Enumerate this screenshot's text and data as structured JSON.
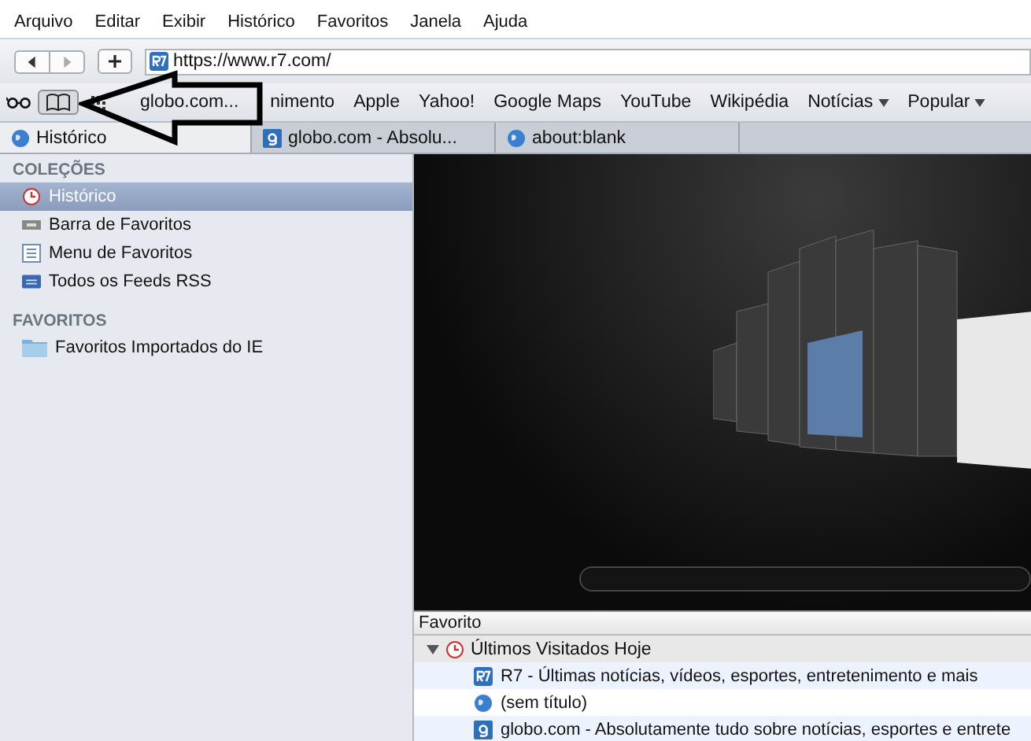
{
  "menu": [
    "Arquivo",
    "Editar",
    "Exibir",
    "Histórico",
    "Favoritos",
    "Janela",
    "Ajuda"
  ],
  "address": {
    "value": "https://www.r7.com/"
  },
  "bookmarks": [
    {
      "label": "globo.com...",
      "menu": false
    },
    {
      "label": "nimento",
      "menu": false
    },
    {
      "label": "Apple",
      "menu": false
    },
    {
      "label": "Yahoo!",
      "menu": false
    },
    {
      "label": "Google Maps",
      "menu": false
    },
    {
      "label": "YouTube",
      "menu": false
    },
    {
      "label": "Wikipédia",
      "menu": false
    },
    {
      "label": "Notícias",
      "menu": true
    },
    {
      "label": "Popular",
      "menu": true
    }
  ],
  "tabs": [
    {
      "label": "Histórico",
      "kind": "globe",
      "selected": true
    },
    {
      "label": "globo.com - Absolu...",
      "kind": "g",
      "selected": false
    },
    {
      "label": "about:blank",
      "kind": "globe",
      "selected": false
    }
  ],
  "sidebar": {
    "sections": [
      {
        "title": "COLEÇÕES",
        "items": [
          {
            "label": "Histórico",
            "kind": "clock",
            "selected": true
          },
          {
            "label": "Barra de Favoritos",
            "kind": "bar",
            "selected": false
          },
          {
            "label": "Menu de Favoritos",
            "kind": "menu",
            "selected": false
          },
          {
            "label": "Todos os Feeds RSS",
            "kind": "rss",
            "selected": false
          }
        ]
      },
      {
        "title": "FAVORITOS",
        "items": [
          {
            "label": "Favoritos Importados do IE",
            "kind": "folder",
            "selected": false
          }
        ]
      }
    ]
  },
  "list": {
    "header": "Favorito",
    "groups": [
      {
        "label": "Últimos Visitados Hoje",
        "expanded": true,
        "children": [
          {
            "label": "R7 - Últimas notícias, vídeos, esportes, entretenimento e mais",
            "kind": "r7"
          },
          {
            "label": "(sem título)",
            "kind": "globe"
          },
          {
            "label": "globo.com - Absolutamente tudo sobre notícias, esportes e entrete",
            "kind": "g"
          }
        ]
      }
    ]
  }
}
